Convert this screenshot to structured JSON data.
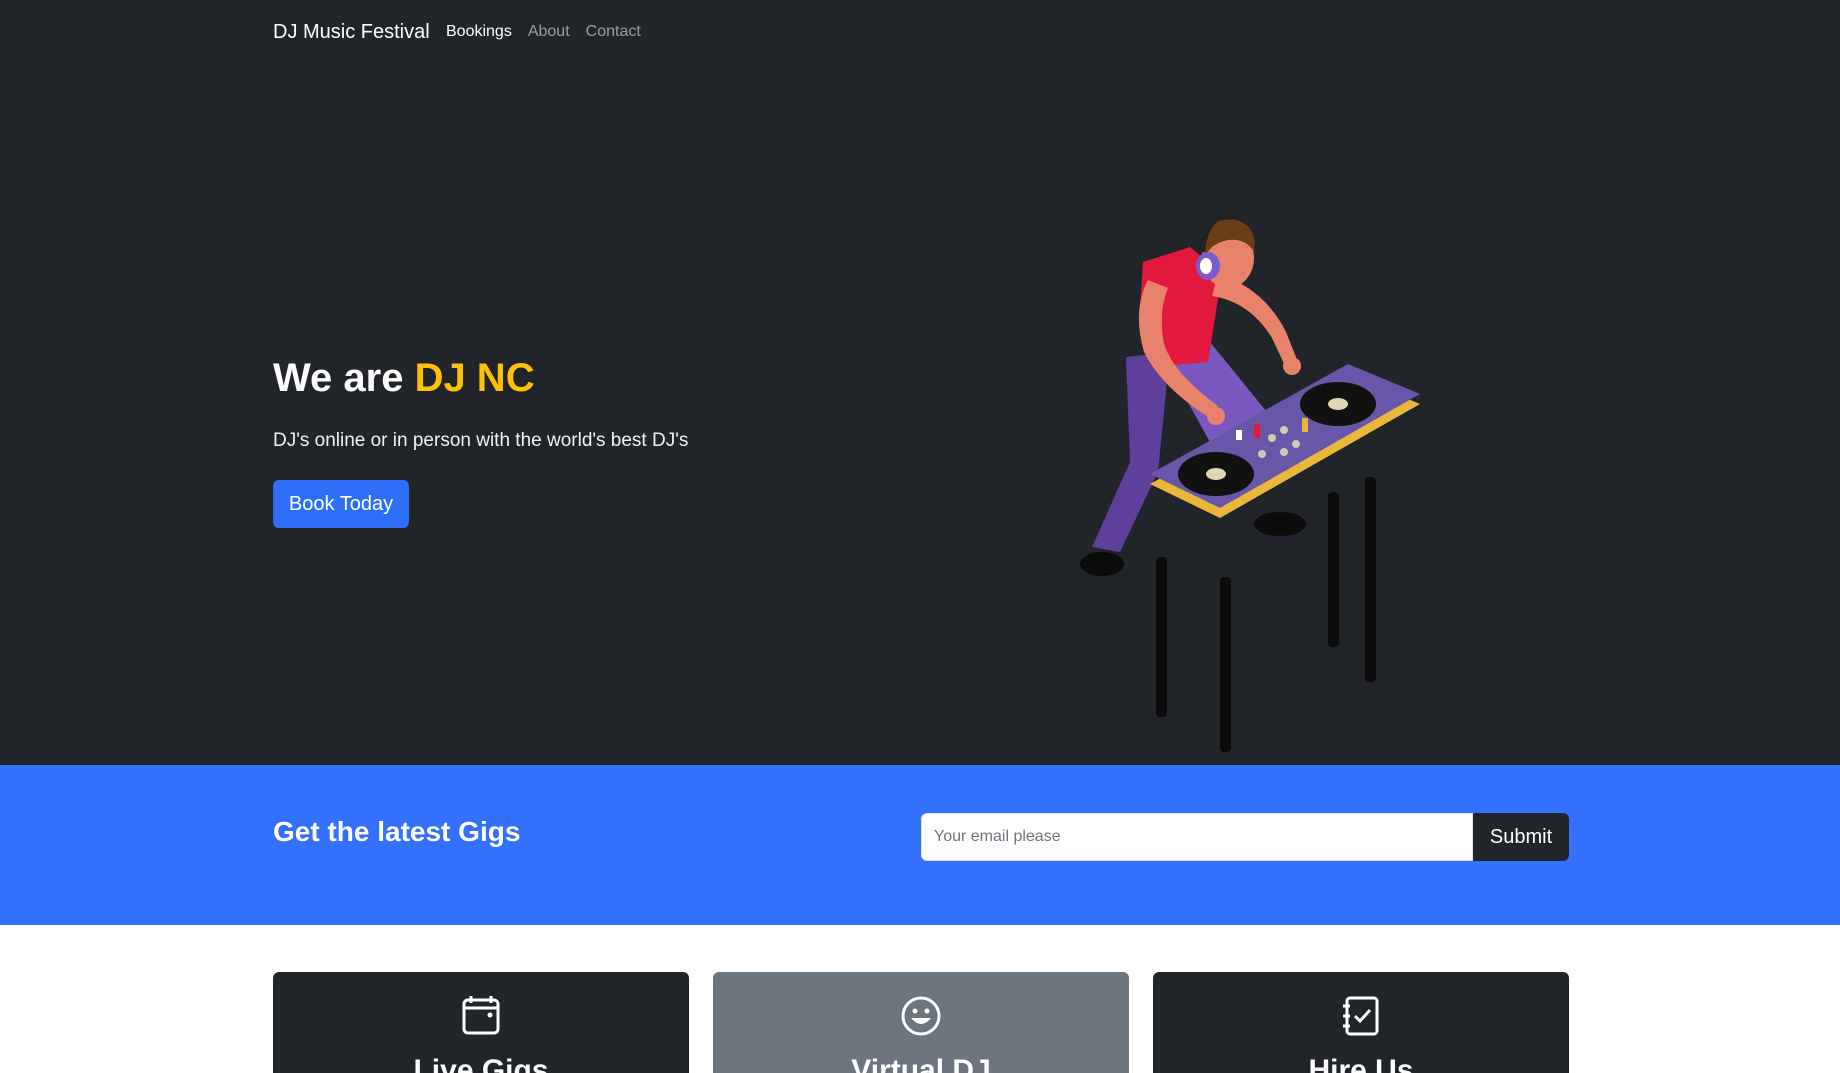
{
  "nav": {
    "brand": "DJ Music Festival",
    "links": [
      {
        "label": "Bookings",
        "active": true
      },
      {
        "label": "About",
        "active": false
      },
      {
        "label": "Contact",
        "active": false
      }
    ]
  },
  "hero": {
    "title_prefix": "We are ",
    "title_accent": "DJ NC",
    "subtitle": "DJ's online or in person with the world's best DJ's",
    "button_label": "Book Today"
  },
  "newsletter": {
    "title": "Get the latest Gigs",
    "email_placeholder": "Your email please",
    "submit_label": "Submit"
  },
  "cards": [
    {
      "title": "Live Gigs",
      "icon": "calendar-icon"
    },
    {
      "title": "Virtual DJ",
      "icon": "smile-icon"
    },
    {
      "title": "Hire Us",
      "icon": "checklist-icon"
    }
  ],
  "colors": {
    "dark": "#212529",
    "accent": "#ffc107",
    "primary": "#3370fd",
    "card_gray": "#6c757d"
  }
}
